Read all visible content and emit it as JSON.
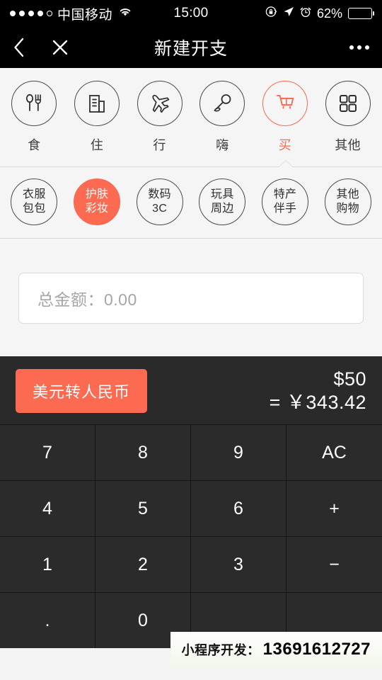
{
  "statusbar": {
    "carrier": "中国移动",
    "time": "15:00",
    "battery_percent": "62%",
    "signal_dots_filled": 4,
    "signal_dots_total": 5,
    "icons": [
      "wifi-icon",
      "rotation-lock-icon",
      "location-arrow-icon",
      "alarm-clock-icon",
      "battery-icon"
    ]
  },
  "navbar": {
    "title": "新建开支",
    "back_icon": "chevron-left-icon",
    "close_icon": "close-icon",
    "more_icon": "more-horizontal-icon"
  },
  "categories": [
    {
      "label": "食",
      "icon": "spoon-fork-icon",
      "active": false
    },
    {
      "label": "住",
      "icon": "building-icon",
      "active": false
    },
    {
      "label": "行",
      "icon": "airplane-icon",
      "active": false
    },
    {
      "label": "嗨",
      "icon": "microphone-icon",
      "active": false
    },
    {
      "label": "买",
      "icon": "shopping-cart-icon",
      "active": true
    },
    {
      "label": "其他",
      "icon": "grid-icon",
      "active": false
    }
  ],
  "subcategories": [
    {
      "line1": "衣服",
      "line2": "包包",
      "active": false
    },
    {
      "line1": "护肤",
      "line2": "彩妆",
      "active": true
    },
    {
      "line1": "数码",
      "line2": "3C",
      "active": false
    },
    {
      "line1": "玩具",
      "line2": "周边",
      "active": false
    },
    {
      "line1": "特产",
      "line2": "伴手",
      "active": false
    },
    {
      "line1": "其他",
      "line2": "购物",
      "active": false
    }
  ],
  "amount_field": {
    "placeholder": "总金额：0.00",
    "value": ""
  },
  "converter": {
    "button_label": "美元转人民币",
    "source_amount": "$50",
    "result_amount": "= ￥343.42"
  },
  "keypad": [
    "7",
    "8",
    "9",
    "AC",
    "4",
    "5",
    "6",
    "+",
    "1",
    "2",
    "3",
    "−",
    ".",
    "0",
    "",
    ""
  ],
  "toast": {
    "label": "小程序开发：",
    "phone": "13691612727"
  },
  "colors": {
    "accent": "#fb6a51",
    "dark_bg": "#2a2a2a",
    "key_bg": "#2b2b2b",
    "page_bg": "#f5f5f5"
  }
}
